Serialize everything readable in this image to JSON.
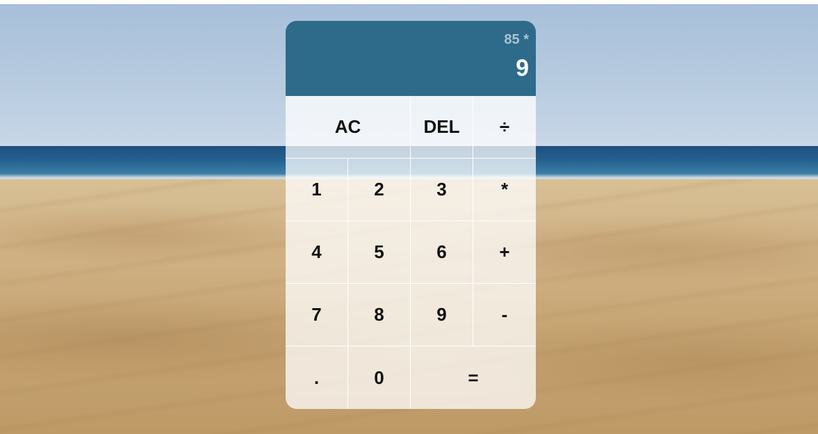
{
  "calculator": {
    "display": {
      "previous_operand": "85 *",
      "current_operand": "9"
    },
    "buttons": {
      "ac": "AC",
      "del": "DEL",
      "divide": "÷",
      "one": "1",
      "two": "2",
      "three": "3",
      "multiply": "*",
      "four": "4",
      "five": "5",
      "six": "6",
      "add": "+",
      "seven": "7",
      "eight": "8",
      "nine": "9",
      "subtract": "-",
      "decimal": ".",
      "zero": "0",
      "equals": "="
    }
  },
  "colors": {
    "display_bg": "#2e6a8a",
    "button_bg": "rgba(255,255,255,0.75)"
  }
}
